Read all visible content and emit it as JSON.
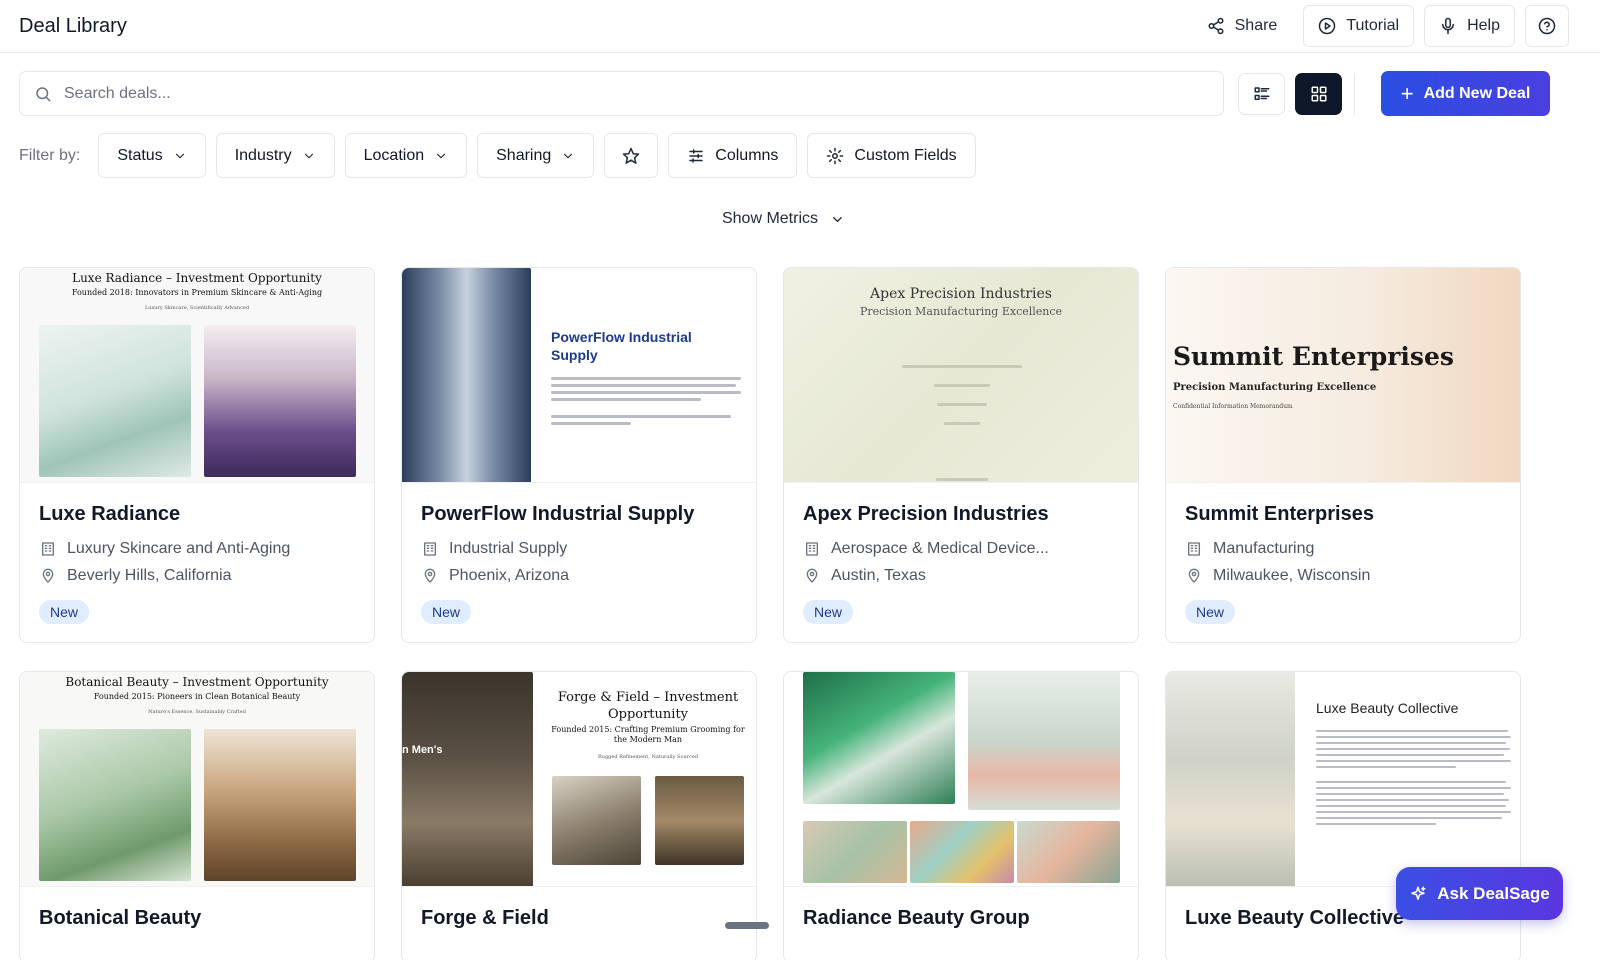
{
  "header": {
    "title": "Deal Library",
    "share": "Share",
    "tutorial": "Tutorial",
    "help": "Help"
  },
  "search": {
    "placeholder": "Search deals..."
  },
  "toolbar": {
    "add_deal": "Add New Deal"
  },
  "filters": {
    "label": "Filter by:",
    "status": "Status",
    "industry": "Industry",
    "location": "Location",
    "sharing": "Sharing",
    "columns": "Columns",
    "custom_fields": "Custom Fields"
  },
  "metrics": {
    "label": "Show Metrics"
  },
  "deals": [
    {
      "name": "Luxe Radiance",
      "industry": "Luxury Skincare and Anti-Aging",
      "location": "Beverly Hills, California",
      "badge": "New",
      "thumb_title": "Luxe Radiance – Investment Opportunity",
      "thumb_sub": "Founded 2018: Innovators in Premium Skincare & Anti-Aging",
      "thumb_tag": "Luxury Skincare, Scientifically Advanced"
    },
    {
      "name": "PowerFlow Industrial Supply",
      "industry": "Industrial Supply",
      "location": "Phoenix, Arizona",
      "badge": "New",
      "thumb_title": "PowerFlow Industrial Supply"
    },
    {
      "name": "Apex Precision Industries",
      "industry": "Aerospace & Medical Device...",
      "location": "Austin, Texas",
      "badge": "New",
      "thumb_title": "Apex Precision Industries",
      "thumb_sub": "Precision Manufacturing Excellence"
    },
    {
      "name": "Summit Enterprises",
      "industry": "Manufacturing",
      "location": "Milwaukee, Wisconsin",
      "badge": "New",
      "thumb_title": "Summit Enterprises",
      "thumb_sub": "Precision Manufacturing Excellence",
      "thumb_tag": "Confidential Information Memorandum"
    },
    {
      "name": "Botanical Beauty",
      "thumb_title": "Botanical Beauty – Investment Opportunity",
      "thumb_sub": "Founded 2015: Pioneers in Clean Botanical Beauty",
      "thumb_tag": "Nature's Essence, Sustainably Crafted"
    },
    {
      "name": "Forge & Field",
      "thumb_title": "Forge & Field – Investment Opportunity",
      "thumb_sub": "Founded 2015: Crafting Premium Grooming for the Modern Man",
      "thumb_tag": "Rugged Refinement, Naturally Sourced",
      "thumb_side": "n Men's"
    },
    {
      "name": "Radiance Beauty Group"
    },
    {
      "name": "Luxe Beauty Collective",
      "thumb_title": "Luxe Beauty Collective"
    }
  ],
  "assistant": {
    "label": "Ask DealSage"
  }
}
